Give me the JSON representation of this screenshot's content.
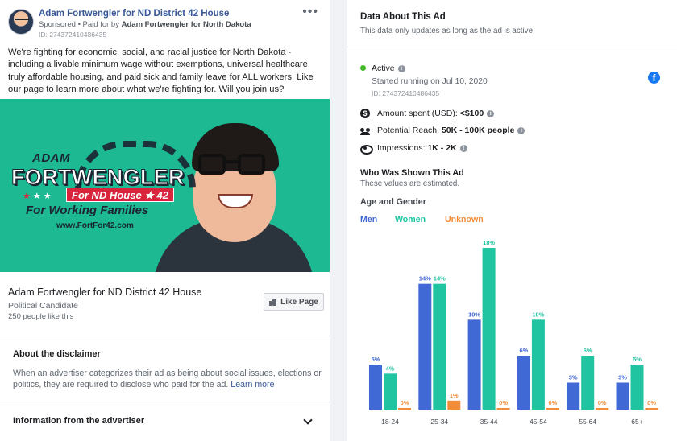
{
  "ad": {
    "page_name": "Adam Fortwengler for ND District 42 House",
    "sponsored_label": "Sponsored",
    "paid_for_prefix": " • Paid for by ",
    "paid_for_by": "Adam Fortwengler for North Dakota",
    "id_text": "ID: 274372410486435",
    "more_icon": "more-dots-icon",
    "body": "We're fighting for economic, social, and racial justice for North Dakota - including a livable minimum wage without exemptions, universal healthcare, truly affordable housing, and paid sick and family leave for ALL workers. Like our page to learn more about what we're fighting for. Will you join us?",
    "creative": {
      "first_name": "ADAM",
      "last_name": "FORTWENGLER",
      "house_badge": "For ND House ★ 42",
      "tagline": "For Working Families",
      "website": "www.FortFor42.com",
      "bg_color": "#1cb992"
    },
    "link": {
      "title": "Adam Fortwengler for ND District 42 House",
      "subtitle": "Political Candidate",
      "likes": "250 people like this",
      "like_button": "Like Page"
    },
    "disclaimer": {
      "title": "About the disclaimer",
      "text": "When an advertiser categorizes their ad as being about social issues, elections or politics, they are required to disclose who paid for the ad. ",
      "link": "Learn more"
    },
    "advertiser_info": {
      "title": "Information from the advertiser"
    }
  },
  "panel": {
    "title": "Data About This Ad",
    "subtitle": "This data only updates as long as the ad is active",
    "status": "Active",
    "started": "Started running on Jul 10, 2020",
    "id_text": "ID: 274372410486435",
    "amount_label": "Amount spent (USD): ",
    "amount_value": "<$100",
    "reach_label": "Potential Reach: ",
    "reach_value": "50K - 100K people",
    "impressions_label": "Impressions: ",
    "impressions_value": "1K - 2K",
    "who_title": "Who Was Shown This Ad",
    "who_sub": "These values are estimated.",
    "age_gender_title": "Age and Gender",
    "legend": {
      "men": "Men",
      "women": "Women",
      "unknown": "Unknown"
    },
    "colors": {
      "men": "#4169d6",
      "women": "#20c4a1",
      "unknown": "#f28c36",
      "active": "#42b72a",
      "facebook": "#1877f2"
    }
  },
  "chart_data": {
    "type": "bar",
    "categories": [
      "18-24",
      "25-34",
      "35-44",
      "45-54",
      "55-64",
      "65+"
    ],
    "series": [
      {
        "name": "Men",
        "values": [
          5,
          14,
          10,
          6,
          3,
          3
        ],
        "labels": [
          "5%",
          "14%",
          "10%",
          "6%",
          "3%",
          "3%"
        ]
      },
      {
        "name": "Women",
        "values": [
          4,
          14,
          18,
          10,
          6,
          5
        ],
        "labels": [
          "4%",
          "14%",
          "18%",
          "10%",
          "6%",
          "5%"
        ]
      },
      {
        "name": "Unknown",
        "values": [
          0,
          1,
          0,
          0,
          0,
          0
        ],
        "labels": [
          "0%",
          "1%",
          "0%",
          "0%",
          "0%",
          "0%"
        ]
      }
    ],
    "ylim": [
      0,
      18
    ],
    "grid": false
  }
}
